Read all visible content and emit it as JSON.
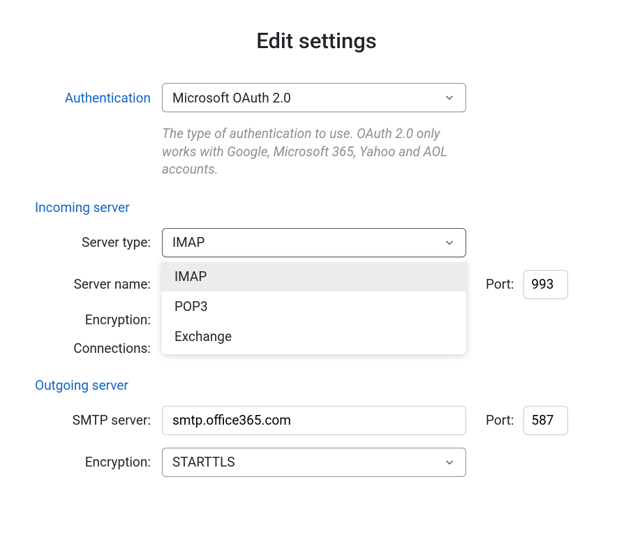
{
  "title": "Edit settings",
  "auth": {
    "label": "Authentication",
    "value": "Microsoft OAuth 2.0",
    "help": "The type of authentication to use. OAuth 2.0 only works with Google, Microsoft 365, Yahoo and AOL accounts."
  },
  "incoming": {
    "heading": "Incoming server",
    "type_label": "Server type:",
    "type_value": "IMAP",
    "type_options": [
      "IMAP",
      "POP3",
      "Exchange"
    ],
    "name_label": "Server name:",
    "port_label": "Port:",
    "port_value": "993",
    "encryption_label": "Encryption:",
    "connections_label": "Connections:"
  },
  "outgoing": {
    "heading": "Outgoing server",
    "smtp_label": "SMTP server:",
    "smtp_value": "smtp.office365.com",
    "port_label": "Port:",
    "port_value": "587",
    "encryption_label": "Encryption:",
    "encryption_value": "STARTTLS"
  }
}
